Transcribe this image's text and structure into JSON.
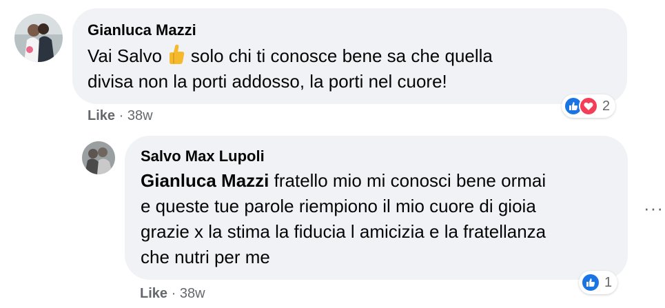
{
  "comments": [
    {
      "author": "Gianluca Mazzi",
      "text_before_emoji": "Vai Salvo",
      "emoji": "thumbs-up-emoji",
      "text_after_emoji_line1": "solo chi ti conosce bene sa che quella",
      "text_line2": "divisa non la porti addosso, la porti nel cuore!",
      "like_label": "Like",
      "separator": "·",
      "time": "38w",
      "reaction_count": "2",
      "reactions": [
        "like",
        "love"
      ]
    },
    {
      "author": "Salvo Max Lupoli",
      "mention": "Gianluca Mazzi",
      "line1_rest": "fratello mio mi conosci bene ormai",
      "line2": "e queste tue parole riempiono il mio cuore di gioia",
      "line3": "grazie x la stima la fiducia l amicizia e la fratellanza",
      "line4": "che nutri per me",
      "like_label": "Like",
      "separator": "·",
      "time": "38w",
      "reaction_count": "1",
      "reactions": [
        "like"
      ],
      "more_label": "···"
    }
  ],
  "colors": {
    "bubble": "#f0f2f5",
    "meta": "#65676b",
    "like_blue": "#1b74e4",
    "love_red": "#f33e58"
  }
}
